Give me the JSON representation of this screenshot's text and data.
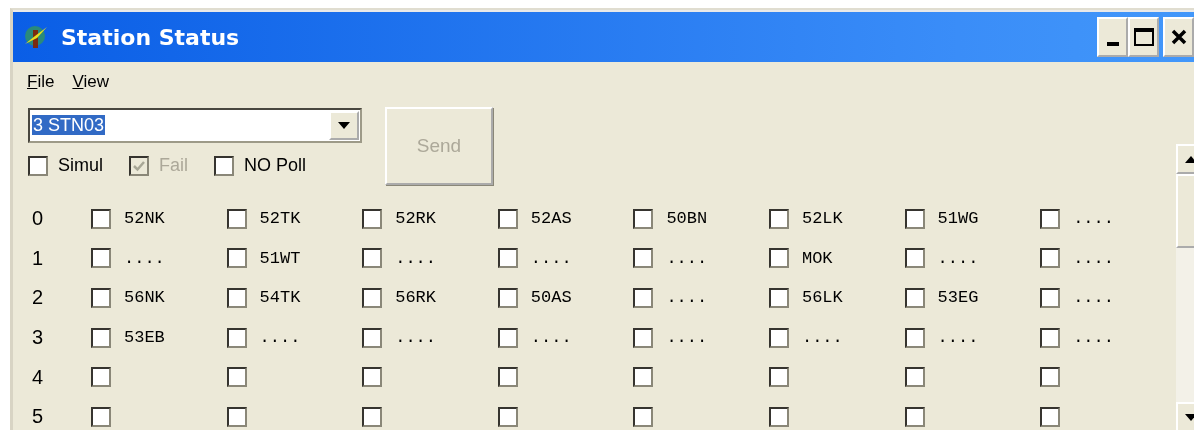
{
  "window": {
    "title": "Station Status"
  },
  "menu": [
    {
      "label": "File"
    },
    {
      "label": "View"
    }
  ],
  "station_select": {
    "value": "3 STN03"
  },
  "options": [
    {
      "label": "Simul",
      "checked": false,
      "disabled": false
    },
    {
      "label": "Fail",
      "checked": true,
      "disabled": true
    },
    {
      "label": "NO Poll",
      "checked": false,
      "disabled": false
    }
  ],
  "send_button": {
    "label": "Send",
    "disabled": true
  },
  "grid": [
    {
      "label": "0",
      "cells": [
        {
          "checked": false,
          "text": "52NK"
        },
        {
          "checked": false,
          "text": "52TK"
        },
        {
          "checked": false,
          "text": "52RK"
        },
        {
          "checked": false,
          "text": "52AS"
        },
        {
          "checked": false,
          "text": "50BN"
        },
        {
          "checked": false,
          "text": "52LK"
        },
        {
          "checked": false,
          "text": "51WG"
        },
        {
          "checked": false,
          "text": "...."
        }
      ]
    },
    {
      "label": "1",
      "cells": [
        {
          "checked": false,
          "text": "...."
        },
        {
          "checked": false,
          "text": "51WT"
        },
        {
          "checked": false,
          "text": "...."
        },
        {
          "checked": false,
          "text": "...."
        },
        {
          "checked": false,
          "text": "...."
        },
        {
          "checked": false,
          "text": "MOK"
        },
        {
          "checked": false,
          "text": "...."
        },
        {
          "checked": false,
          "text": "...."
        }
      ]
    },
    {
      "label": "2",
      "cells": [
        {
          "checked": false,
          "text": "56NK"
        },
        {
          "checked": false,
          "text": "54TK"
        },
        {
          "checked": false,
          "text": "56RK"
        },
        {
          "checked": false,
          "text": "50AS"
        },
        {
          "checked": false,
          "text": "...."
        },
        {
          "checked": false,
          "text": "56LK"
        },
        {
          "checked": false,
          "text": "53EG"
        },
        {
          "checked": false,
          "text": "...."
        }
      ]
    },
    {
      "label": "3",
      "cells": [
        {
          "checked": false,
          "text": "53EB"
        },
        {
          "checked": false,
          "text": "...."
        },
        {
          "checked": false,
          "text": "...."
        },
        {
          "checked": false,
          "text": "...."
        },
        {
          "checked": false,
          "text": "...."
        },
        {
          "checked": false,
          "text": "...."
        },
        {
          "checked": false,
          "text": "...."
        },
        {
          "checked": false,
          "text": "...."
        }
      ]
    },
    {
      "label": "4",
      "cells": [
        {
          "checked": false
        },
        {
          "checked": false
        },
        {
          "checked": false
        },
        {
          "checked": false
        },
        {
          "checked": false
        },
        {
          "checked": false
        },
        {
          "checked": false
        },
        {
          "checked": false
        }
      ]
    },
    {
      "label": "5",
      "cells": [
        {
          "checked": false
        },
        {
          "checked": false
        },
        {
          "checked": false
        },
        {
          "checked": false
        },
        {
          "checked": false
        },
        {
          "checked": false
        },
        {
          "checked": false
        },
        {
          "checked": false
        }
      ]
    }
  ]
}
